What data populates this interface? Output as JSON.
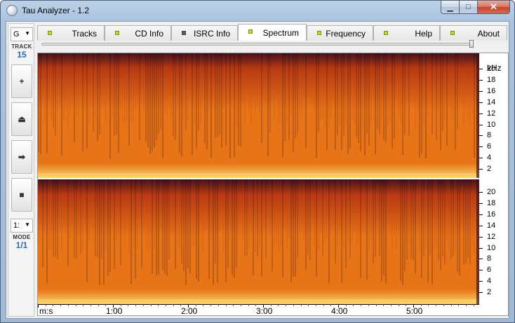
{
  "window": {
    "title": "Tau Analyzer - 1.2"
  },
  "caption_buttons": {
    "minimize": "▁",
    "maximize": "□",
    "close": "✕"
  },
  "left_toolbar": {
    "gain_select": {
      "value": "G"
    },
    "track_label": "TRACK",
    "track_number": "15",
    "buttons": [
      {
        "name": "zoom-in-button",
        "glyph": "+"
      },
      {
        "name": "eject-button",
        "glyph": "⏏"
      },
      {
        "name": "play-button",
        "glyph": "➡"
      },
      {
        "name": "stop-button",
        "glyph": "■"
      }
    ],
    "mode_select": {
      "value": "1:"
    },
    "mode_label": "MODE",
    "mode_value": "1/1"
  },
  "tabs": [
    {
      "label": "Tracks",
      "led": "on"
    },
    {
      "label": "CD Info",
      "led": "on"
    },
    {
      "label": "ISRC Info",
      "led": "off"
    },
    {
      "label": "Spectrum",
      "led": "on",
      "active": true
    },
    {
      "label": "Frequency",
      "led": "on"
    },
    {
      "label": "Help",
      "led": "on"
    },
    {
      "label": "About",
      "led": "on"
    }
  ],
  "spectrum": {
    "frequency_unit": "kHz",
    "frequency_ticks": [
      "20",
      "18",
      "16",
      "14",
      "12",
      "10",
      "8",
      "6",
      "4",
      "2"
    ],
    "time_axis_label": "m:s",
    "time_ticks": [
      "1:00",
      "2:00",
      "3:00",
      "4:00",
      "5:00"
    ],
    "colors": {
      "high": "#fbd36a",
      "mid": "#e87418",
      "low": "#b83a12",
      "deep": "#3a0f1c"
    }
  }
}
